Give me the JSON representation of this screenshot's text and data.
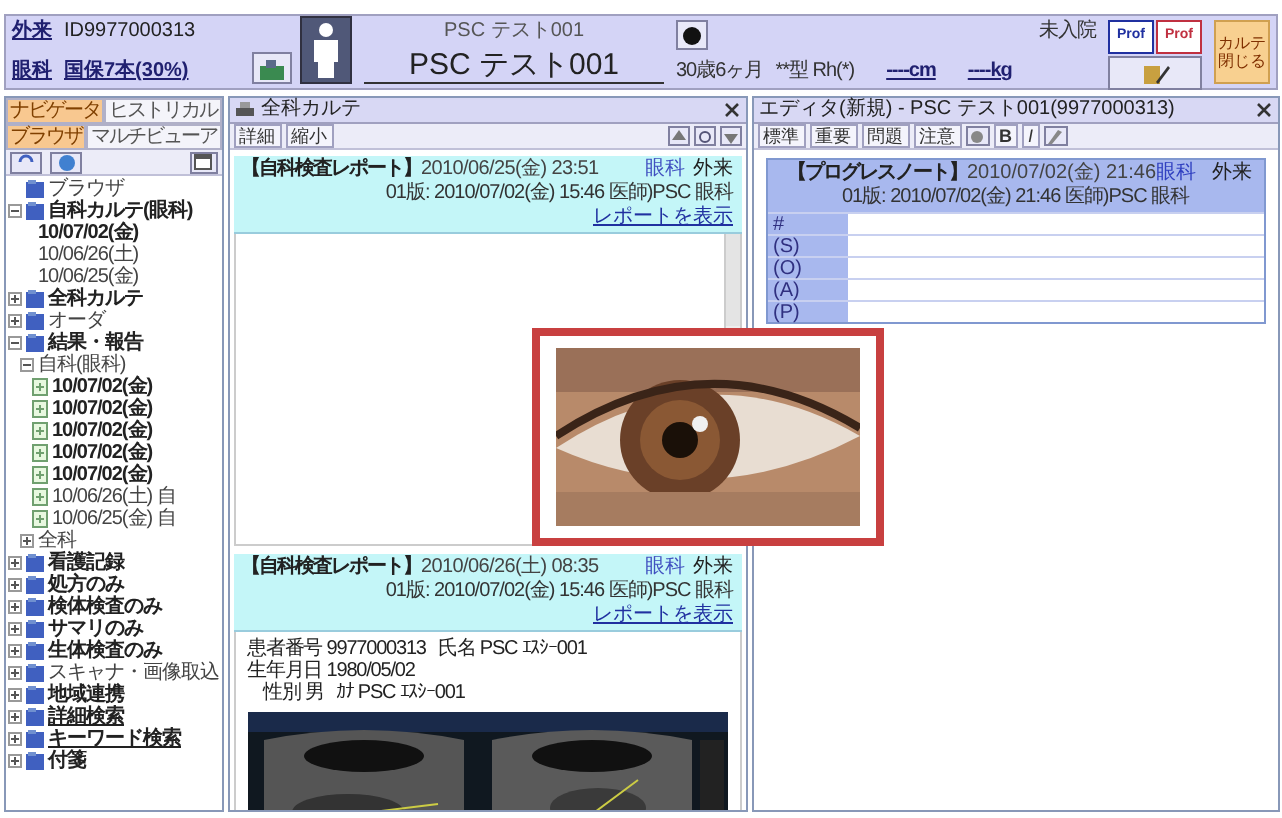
{
  "header": {
    "visit_type": "外来",
    "department": "眼科",
    "patient_id": "ID9977000313",
    "insurance": "国保7本(30%)",
    "name_kana": "PSC テスト001",
    "name": "PSC テスト001",
    "age": "30歳6ヶ月",
    "blood_type": "**型 Rh(*)",
    "height": "----cm",
    "weight": "----kg",
    "admission_status": "未入院",
    "prof_buttons": [
      {
        "label": "Prof",
        "kind": "blue"
      },
      {
        "label": "Prof",
        "kind": "red"
      }
    ],
    "close_button": "カルテ閉じる"
  },
  "navigator": {
    "tab_rows": [
      [
        {
          "label": "ナビゲータ",
          "selected": true
        },
        {
          "label": "ヒストリカル",
          "selected": false
        }
      ],
      [
        {
          "label": "ブラウザ",
          "selected": true
        },
        {
          "label": "マルチビューア",
          "selected": false
        }
      ]
    ],
    "tree": [
      {
        "label": "ブラウザ",
        "bold": false,
        "underlined": false
      },
      {
        "label": "自科カルテ(眼科)",
        "bold": true,
        "underlined": false,
        "expanded": true,
        "children": [
          {
            "label": "10/07/02(金)",
            "bold": true
          },
          {
            "label": "10/06/26(土)",
            "bold": false
          },
          {
            "label": "10/06/25(金)",
            "bold": false
          }
        ]
      },
      {
        "label": "全科カルテ",
        "bold": true,
        "underlined": false,
        "expanded": false
      },
      {
        "label": "オーダ",
        "bold": false,
        "underlined": false,
        "expanded": false
      },
      {
        "label": "結果・報告",
        "bold": true,
        "underlined": false,
        "expanded": true,
        "children": [
          {
            "label": "自科(眼科)",
            "bold": false,
            "expanded": true,
            "children": [
              {
                "label": "10/07/02(金)",
                "bold": true
              },
              {
                "label": "10/07/02(金)",
                "bold": true
              },
              {
                "label": "10/07/02(金)",
                "bold": true
              },
              {
                "label": "10/07/02(金)",
                "bold": true
              },
              {
                "label": "10/07/02(金)",
                "bold": true
              },
              {
                "label": "10/06/26(土) 自",
                "bold": false
              },
              {
                "label": "10/06/25(金) 自",
                "bold": false
              }
            ]
          },
          {
            "label": "全科",
            "bold": false,
            "expanded": false
          }
        ]
      },
      {
        "label": "看護記録",
        "bold": true,
        "underlined": false,
        "expanded": false
      },
      {
        "label": "処方のみ",
        "bold": true,
        "underlined": false,
        "expanded": false
      },
      {
        "label": "検体検査のみ",
        "bold": true,
        "underlined": false,
        "expanded": false
      },
      {
        "label": "サマリのみ",
        "bold": true,
        "underlined": false,
        "expanded": false
      },
      {
        "label": "生体検査のみ",
        "bold": true,
        "underlined": false,
        "expanded": false
      },
      {
        "label": "スキャナ・画像取込",
        "bold": false,
        "underlined": false,
        "expanded": false
      },
      {
        "label": "地域連携",
        "bold": true,
        "underlined": false,
        "expanded": false
      },
      {
        "label": "詳細検索",
        "bold": true,
        "underlined": true,
        "expanded": false
      },
      {
        "label": "キーワード検索",
        "bold": true,
        "underlined": true,
        "expanded": false
      },
      {
        "label": "付箋",
        "bold": true,
        "underlined": false,
        "expanded": false
      }
    ]
  },
  "chart_panel": {
    "title": "全科カルテ",
    "toolbar": [
      "詳細",
      "縮小"
    ],
    "reports": [
      {
        "title": "【自科検査レポート】",
        "datetime": "2010/06/25(金) 23:51",
        "department": "眼科",
        "visit": "外来",
        "version": "01版: 2010/07/02(金) 15:46 医師)PSC 眼科",
        "link": "レポートを表示"
      },
      {
        "title": "【自科検査レポート】",
        "datetime": "2010/06/26(土) 08:35",
        "department": "眼科",
        "visit": "外来",
        "version": "01版: 2010/07/02(金) 15:46 医師)PSC 眼科",
        "link": "レポートを表示",
        "patient_fields": [
          [
            "患者番号 9977000313",
            "氏名 PSC ｴｽｼｰ001",
            "生年月日 1980/05/02"
          ],
          [
            "性別 男",
            "ｶﾅ PSC ｴｽｼｰ001"
          ]
        ],
        "kind": "picture"
      }
    ]
  },
  "editor_panel": {
    "title": "エディタ(新規) - PSC テスト001(9977000313)",
    "toolbar": [
      "標準",
      "重要",
      "問題",
      "注意"
    ],
    "format_buttons": [
      {
        "label": "B",
        "kind": "bold"
      },
      {
        "label": "I",
        "kind": "italic"
      }
    ],
    "note": {
      "title": "【プログレスノート】",
      "datetime": "2010/07/02(金) 21:46",
      "department": "眼科",
      "visit": "外来",
      "version": "01版: 2010/07/02(金) 21:46 医師)PSC 眼科",
      "rows": [
        "#",
        "(S)",
        "(O)",
        "(A)",
        "(P)"
      ]
    }
  }
}
